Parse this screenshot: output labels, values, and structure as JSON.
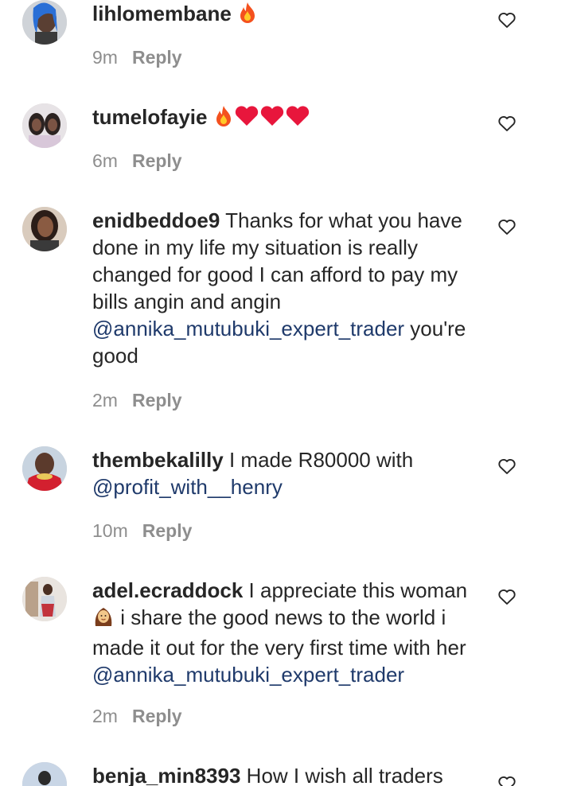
{
  "comments": [
    {
      "username": "lihlomembane",
      "text_before": "",
      "mention": "",
      "text_after": "",
      "emojis": [
        "fire"
      ],
      "time": "9m",
      "reply": "Reply"
    },
    {
      "username": "tumelofayie",
      "text_before": "",
      "mention": "",
      "text_after": "",
      "emojis": [
        "fire",
        "red-heart",
        "red-heart",
        "red-heart"
      ],
      "time": "6m",
      "reply": "Reply"
    },
    {
      "username": "enidbeddoe9",
      "text_before": " Thanks for what you have done in my life my situation is really changed for good I can afford to pay my bills angin and angin ",
      "mention": "@annika_mutubuki_expert_trader",
      "text_after": " you're good",
      "emojis": [],
      "time": "2m",
      "reply": "Reply"
    },
    {
      "username": "thembekalilly",
      "text_before": " I made R80000 with ",
      "mention": "@profit_with__henry",
      "text_after": "",
      "emojis": [],
      "time": "10m",
      "reply": "Reply"
    },
    {
      "username": "adel.ecraddock",
      "text_before": " I appreciate this woman ",
      "emoji_inline": "woman",
      "text_middle": " i share the good news to the world i made it out for the very first time with her ",
      "mention": "@annika_mutubuki_expert_trader",
      "text_after": "",
      "emojis": [],
      "time": "2m",
      "reply": "Reply"
    },
    {
      "username": "benja_min8393",
      "text_before": " How I wish all traders",
      "mention": "",
      "text_after": "",
      "emojis": [],
      "time": "",
      "reply": ""
    }
  ],
  "icons": {
    "like": "heart-outline-icon"
  },
  "colors": {
    "text": "#262626",
    "meta": "#8e8e8e",
    "mention": "#1f3a6b",
    "heart_emoji": "#e8163c",
    "fire_outer": "#f4511e",
    "fire_inner": "#ffca28"
  }
}
